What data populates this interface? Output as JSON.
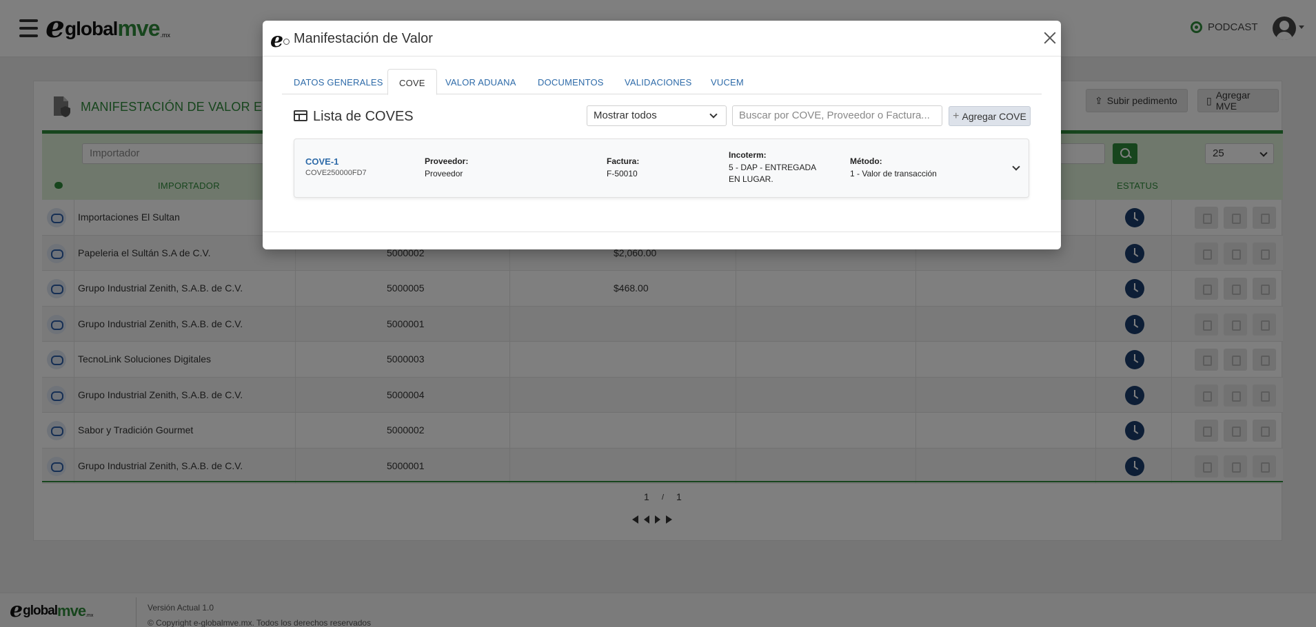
{
  "header": {
    "logo_e": "e",
    "logo_global": "global",
    "logo_mve": "mve",
    "logo_mx": ".mx",
    "podcast_label": "PODCAST"
  },
  "page": {
    "title": "MANIFESTACIÓN DE VALOR ELEC",
    "btn_subir": "Subir pedimento",
    "btn_agregar": "Agregar MVE",
    "filter_importador_placeholder": "Importador",
    "page_size": "25",
    "col_importador": "IMPORTADOR",
    "col_estatus": "ESTATUS",
    "rows": [
      {
        "name": "Importaciones El Sultan",
        "num": "",
        "amount": ""
      },
      {
        "name": "Papeleria el Sultán S.A de C.V.",
        "num": "5000002",
        "amount": "$2,060.00"
      },
      {
        "name": "Grupo Industrial Zenith, S.A.B. de C.V.",
        "num": "5000005",
        "amount": "$468.00"
      },
      {
        "name": "Grupo Industrial Zenith, S.A.B. de C.V.",
        "num": "5000001",
        "amount": ""
      },
      {
        "name": "TecnoLink Soluciones Digitales",
        "num": "5000003",
        "amount": ""
      },
      {
        "name": "Grupo Industrial Zenith, S.A.B. de C.V.",
        "num": "5000004",
        "amount": ""
      },
      {
        "name": "Sabor y Tradición Gourmet",
        "num": "5000002",
        "amount": ""
      },
      {
        "name": "Grupo Industrial Zenith, S.A.B. de C.V.",
        "num": "5000001",
        "amount": ""
      }
    ],
    "pager_current": "1",
    "pager_sep": "/",
    "pager_total": "1"
  },
  "footer": {
    "version": "Versión Actual 1.0",
    "copyright": "© Copyright e-globalmve.mx. Todos los derechos reservados"
  },
  "modal": {
    "title": "Manifestación de Valor",
    "tabs": [
      {
        "label": "DATOS GENERALES"
      },
      {
        "label": "COVE"
      },
      {
        "label": "VALOR ADUANA"
      },
      {
        "label": "DOCUMENTOS"
      },
      {
        "label": "VALIDACIONES"
      },
      {
        "label": "VUCEM"
      }
    ],
    "list_title": "Lista de COVES",
    "filter_value": "Mostrar todos",
    "search_placeholder": "Buscar por COVE, Proveedor o Factura...",
    "add_button": "Agregar COVE",
    "cove": {
      "name": "COVE-1",
      "id": "COVE250000FD7",
      "proveedor_label": "Proveedor:",
      "proveedor_value": "Proveedor",
      "factura_label": "Factura:",
      "factura_value": "F-50010",
      "incoterm_label": "Incoterm:",
      "incoterm_value": "5 - DAP - ENTREGADA EN LUGAR.",
      "metodo_label": "Método:",
      "metodo_value": "1 - Valor de transacción"
    }
  },
  "colors": {
    "brand_green": "#2e8b3a",
    "link_blue": "#2d6aa8",
    "status_navy": "#1b3d6d"
  }
}
